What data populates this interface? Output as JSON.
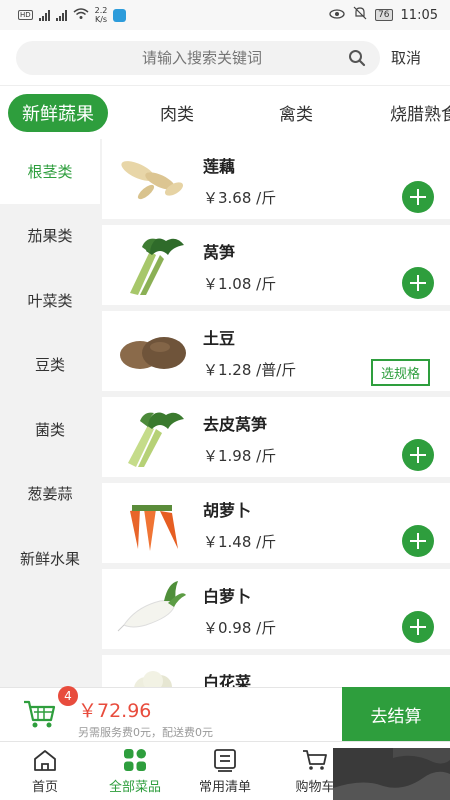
{
  "status_bar": {
    "left": "HD 4G 4G",
    "speed": "2.2\nK/s",
    "battery": "76",
    "time": "11:05"
  },
  "search": {
    "placeholder": "请输入搜索关键词",
    "cancel_label": "取消"
  },
  "tabs": [
    "新鲜蔬果",
    "肉类",
    "禽类",
    "烧腊熟食"
  ],
  "sidebar": [
    "根茎类",
    "茄果类",
    "叶菜类",
    "豆类",
    "菌类",
    "葱姜蒜",
    "新鲜水果"
  ],
  "products": [
    {
      "name": "莲藕",
      "price": "￥3.68 /斤",
      "action": "add"
    },
    {
      "name": "莴笋",
      "price": "￥1.08 /斤",
      "action": "add"
    },
    {
      "name": "土豆",
      "price": "￥1.28 /普/斤",
      "action": "spec",
      "spec_label": "选规格"
    },
    {
      "name": "去皮莴笋",
      "price": "￥1.98 /斤",
      "action": "add"
    },
    {
      "name": "胡萝卜",
      "price": "￥1.48 /斤",
      "action": "add"
    },
    {
      "name": "白萝卜",
      "price": "￥0.98 /斤",
      "action": "add"
    },
    {
      "name": "白花菜",
      "price": "",
      "action": "none"
    }
  ],
  "cart": {
    "count": "4",
    "total": "￥72.96",
    "note": "另需服务费0元，配送费0元",
    "checkout_label": "去结算"
  },
  "nav": [
    {
      "label": "首页",
      "icon": "home-icon"
    },
    {
      "label": "全部菜品",
      "icon": "grid-icon"
    },
    {
      "label": "常用清单",
      "icon": "list-icon"
    },
    {
      "label": "购物车",
      "icon": "cart-icon"
    }
  ],
  "colors": {
    "accent": "#2e9e3d",
    "price_red": "#e84c3d"
  }
}
